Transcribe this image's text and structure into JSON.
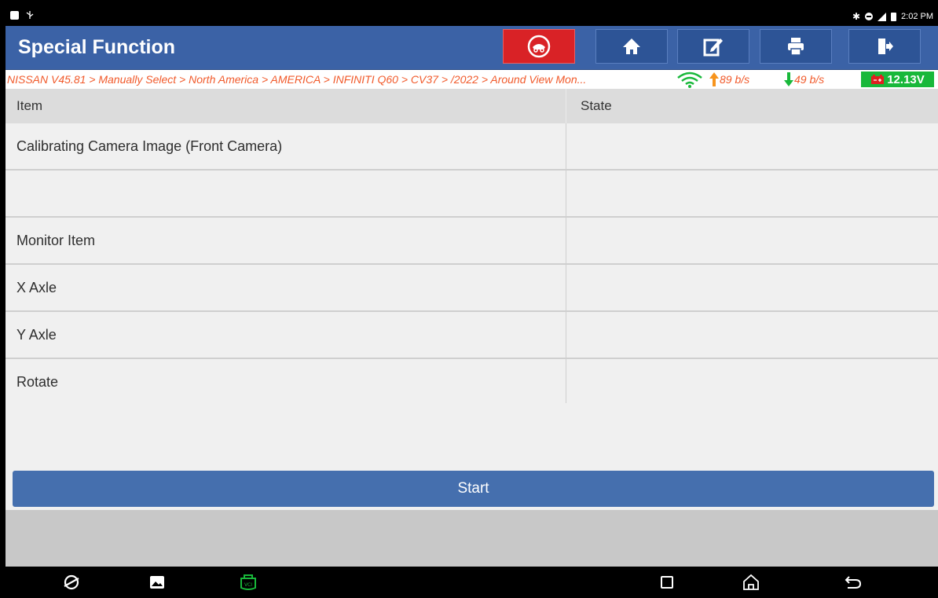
{
  "status_bar": {
    "time": "2:02 PM"
  },
  "header": {
    "title": "Special Function"
  },
  "toolbar": {
    "buttons": [
      {
        "icon": "vehicle-icon",
        "color": "#d92226"
      },
      {
        "icon": "home-icon"
      },
      {
        "icon": "edit-icon"
      },
      {
        "icon": "print-icon"
      },
      {
        "icon": "exit-icon"
      }
    ]
  },
  "breadcrumb": {
    "path": "NISSAN V45.81 > Manually Select > North America > AMERICA > INFINITI Q60 > CV37 > /2022 > Around View Mon...",
    "upload": "89 b/s",
    "download": "49 b/s",
    "voltage": "12.13V"
  },
  "table": {
    "columns": [
      "Item",
      "State"
    ],
    "rows": [
      {
        "item": "Calibrating Camera Image (Front Camera)",
        "state": ""
      },
      {
        "item": "",
        "state": ""
      },
      {
        "item": "Monitor Item",
        "state": ""
      },
      {
        "item": "X Axle",
        "state": ""
      },
      {
        "item": "Y Axle",
        "state": ""
      },
      {
        "item": "Rotate",
        "state": ""
      }
    ]
  },
  "actions": {
    "start_label": "Start"
  },
  "colors": {
    "header_bg": "#3b62a6",
    "accent_orange": "#f15a2b",
    "voltage_green": "#18b83a",
    "button_blue": "#456fae"
  }
}
